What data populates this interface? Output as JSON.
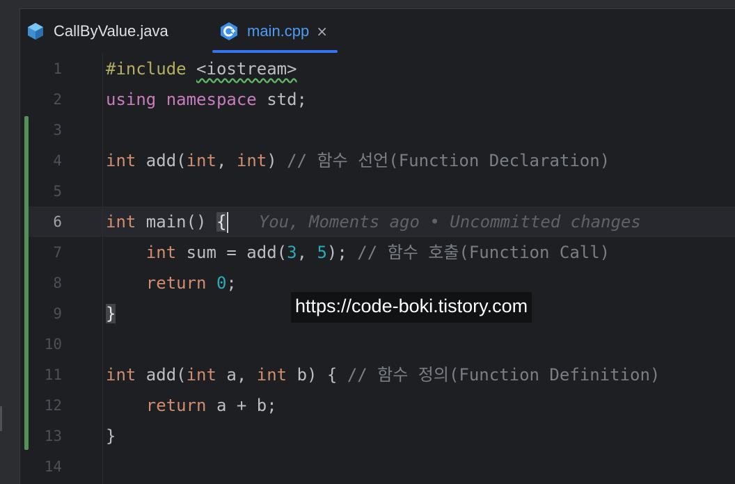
{
  "tabs": [
    {
      "label": "CallByValue.java",
      "icon": "java-class-icon",
      "active": false
    },
    {
      "label": "main.cpp",
      "icon": "cpp-file-icon",
      "active": true,
      "close": "×"
    }
  ],
  "editor": {
    "line_numbers": [
      "1",
      "2",
      "3",
      "4",
      "5",
      "6",
      "7",
      "8",
      "9",
      "10",
      "11",
      "12",
      "13",
      "14"
    ],
    "current_line": "6",
    "lines": {
      "l1": {
        "directive": "#include",
        "sp": " ",
        "header": "<iostream>"
      },
      "l2": {
        "kw_using": "using",
        "kw_namespace": "namespace",
        "rest": " std;"
      },
      "l4": {
        "t1": "int",
        "fn": " add(",
        "t2": "int",
        "sep": ", ",
        "t3": "int",
        "close": ") ",
        "comment": "// 함수 선언(Function Declaration)"
      },
      "l6": {
        "t1": "int",
        "fn": " main() ",
        "brace": "{",
        "blame": "   You, Moments ago • Uncommitted changes"
      },
      "l7": {
        "indent": "    ",
        "t1": "int",
        "mid": " sum = add(",
        "n1": "3",
        "sep": ", ",
        "n2": "5",
        "end": "); ",
        "comment": "// 함수 호출(Function Call)"
      },
      "l8": {
        "indent": "    ",
        "kw": "return",
        "sp": " ",
        "n": "0",
        "end": ";"
      },
      "l9": {
        "brace": "}"
      },
      "l11": {
        "t1": "int",
        "fn": " add(",
        "t2": "int",
        "a": " a, ",
        "t3": "int",
        "b": " b) { ",
        "comment": "// 함수 정의(Function Definition)"
      },
      "l12": {
        "indent": "    ",
        "kw": "return",
        "rest": " a + b;"
      },
      "l13": {
        "brace": "}"
      }
    }
  },
  "watermark": "https://code-boki.tistory.com",
  "colors": {
    "background": "#1e1f22",
    "keyword": "#cf8e6d",
    "number": "#2aacb8",
    "comment": "#7a7e85",
    "vcs_added": "#549159",
    "tab_accent": "#3574f0"
  }
}
